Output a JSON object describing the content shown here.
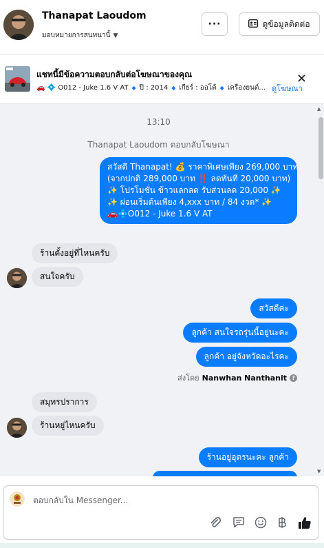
{
  "header": {
    "contact_name": "Thanapat Laoudom",
    "assign_label": "มอบหมายการสนทนานี้",
    "more_label": "···",
    "contact_info_label": "ดูข้อมูลติดต่อ"
  },
  "ad": {
    "title": "แชทนี้มีข้อความตอบกลับต่อโฆษณาของคุณ",
    "meta": [
      "🚗 💠 O012 - Juke 1.6 V AT",
      "ปี : 2014",
      "เกียร์ : ออโต้",
      "เครื่องยนต์..."
    ],
    "view_ad_label": "ดูโฆษณา"
  },
  "chat": {
    "time": "13:10",
    "system_note": "Thanapat Laoudom ตอบกลับโฆษณา",
    "ad_message_lines": [
      "สวัสดี Thanapat! 💰 ราคาพิเศษเพียง 269,000 บาท",
      "(จากปกติ 289,000 บาท ‼️ ลดทันที 20,000 บาท)",
      "✨ โปรโมชั่น ข้าวแลกลด รับส่วนลด 20,000 ✨",
      "✨ ผ่อนเริ่มต้นเพียง 4,xxx บาท / 84 งวด* ✨",
      "🚗💠O012 - Juke 1.6 V AT"
    ],
    "in_1a": "ร้านตั้งอยู่ที่ไหนครับ",
    "in_1b": "สนใจครับ",
    "out_1": "สวัสดีค่ะ",
    "out_2": "ลูกค้า สนใจรถรุ่นนี้อยู่นะคะ",
    "out_3": "ลูกค้า อยู่จังหวัดอะไรคะ",
    "sent_by_label": "ส่งโดย",
    "sent_by_name": "Nanwhan Nanthanit",
    "in_2a": "สมุทรปราการ",
    "in_2b": "ร้านหยู่ไหนครับ",
    "out_4": "ร้านอยู่อุดรนะคะ  ลูกค้า"
  },
  "reply": {
    "placeholder": "ตอบกลับใน Messenger..."
  },
  "icons": {
    "attach": "paperclip-icon",
    "saved_reply": "chat-bubble-icon",
    "emoji": "smiley-icon",
    "payment": "baht-icon",
    "like": "thumbs-up-icon"
  },
  "colors": {
    "outgoing_bubble": "#0a7cff",
    "incoming_bubble": "#e4e6eb",
    "chat_background": "#f0f2f5",
    "link": "#1877f2"
  }
}
